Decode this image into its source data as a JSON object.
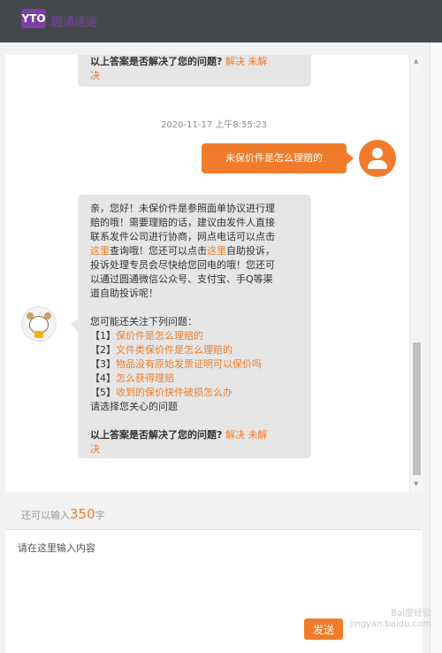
{
  "header": {
    "logo_mark": "YTO",
    "logo_text": "圆通速递"
  },
  "chat": {
    "messages": [
      {
        "lines": [
          "以上答案是否解决了您的问题?",
          "解决",
          "未解",
          "决"
        ]
      },
      {
        "timestamp": "2020-11-17 上午8:55:23"
      },
      {
        "user_text": "未保价件是怎么理赔的"
      },
      {
        "intro": [
          "亲，您好！未保价件是参照面单协议进行理",
          "赔的哦！需要理赔的话，建议由发件人直接",
          "联系发件公司进行协商，网点电话可以点击",
          "这里",
          "查询哦！您还可以点击",
          "这里",
          "自助投诉，",
          "投诉处理专员会尽快给您回电的哦！您还可",
          "以通过圆通微信公众号、支付宝、手Q等渠",
          "道自助投诉呢！"
        ],
        "related_title": "您可能还关注下列问题：",
        "related": [
          {
            "num": "【1】",
            "text": "保价件是怎么理赔的"
          },
          {
            "num": "【2】",
            "text": "文件类保价件是怎么理赔的"
          },
          {
            "num": "【3】",
            "text": "物品没有原始发票证明可以保价吗"
          },
          {
            "num": "【4】",
            "text": "怎么获得理赔"
          },
          {
            "num": "【5】",
            "text": "收到的保价快件破损怎么办"
          }
        ],
        "choose": "请选择您关心的问题",
        "feedback": {
          "question": "以上答案是否解决了您的问题?",
          "yes": "解决",
          "no": "未解",
          "no_tail": "决"
        }
      }
    ]
  },
  "composer": {
    "counter_prefix": "还可以输入",
    "counter_value": "350",
    "counter_suffix": "字",
    "placeholder": "请在这里输入内容",
    "send_label": "发送"
  },
  "watermark": {
    "line1": "Bai度经验",
    "line2": "jingyan.baidu.com"
  },
  "colors": {
    "accent": "#f07c2b",
    "topbar": "#45484b",
    "brand": "#7b3fa6"
  },
  "icons": {
    "user_avatar": "user-avatar-icon",
    "bot_avatar": "mascot-avatar-icon"
  }
}
